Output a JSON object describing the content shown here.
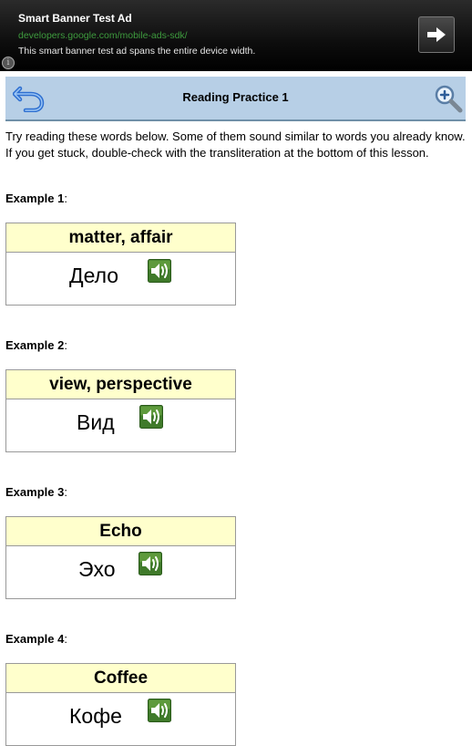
{
  "ad": {
    "title": "Smart Banner Test Ad",
    "url": "developers.google.com/mobile-ads-sdk/",
    "description": "This smart banner test ad spans the entire device width.",
    "info_glyph": "i"
  },
  "header": {
    "title": "Reading Practice 1"
  },
  "intro": "Try reading these words below. Some of them sound similar to words you already know. If you get stuck, double-check with the transliteration at the bottom of this lesson.",
  "examples": [
    {
      "label": "Example 1",
      "suffix": ":",
      "meaning": "matter, affair",
      "word": "Дело"
    },
    {
      "label": "Example 2",
      "suffix": ":",
      "meaning": "view, perspective",
      "word": "Вид"
    },
    {
      "label": "Example 3",
      "suffix": ":",
      "meaning": "Echo",
      "word": "Эхо"
    },
    {
      "label": "Example 4",
      "suffix": ":",
      "meaning": "Coffee",
      "word": "Кофе"
    }
  ],
  "colors": {
    "header_bg": "#b7cfe6",
    "card_header_bg": "#ffffcc",
    "sound_icon_green": "#3f7a2a",
    "ad_url_green": "#3e9b3e"
  }
}
